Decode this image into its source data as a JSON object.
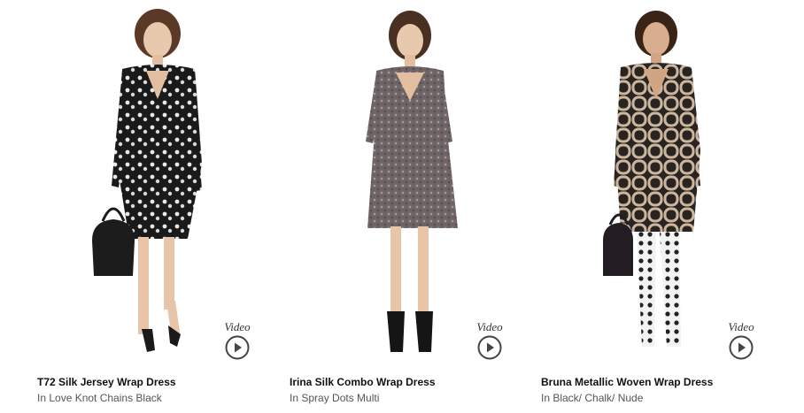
{
  "products": [
    {
      "name": "T72 Silk Jersey Wrap Dress",
      "color_text": "In Love Knot Chains Black",
      "video_label": "Video"
    },
    {
      "name": "Irina Silk Combo Wrap Dress",
      "color_text": "In Spray Dots Multi",
      "video_label": "Video"
    },
    {
      "name": "Bruna Metallic Woven Wrap Dress",
      "color_text": "In Black/ Chalk/ Nude",
      "video_label": "Video"
    }
  ],
  "colors": {
    "title": "#111111",
    "subtitle": "#555555",
    "accent": "#333333"
  }
}
